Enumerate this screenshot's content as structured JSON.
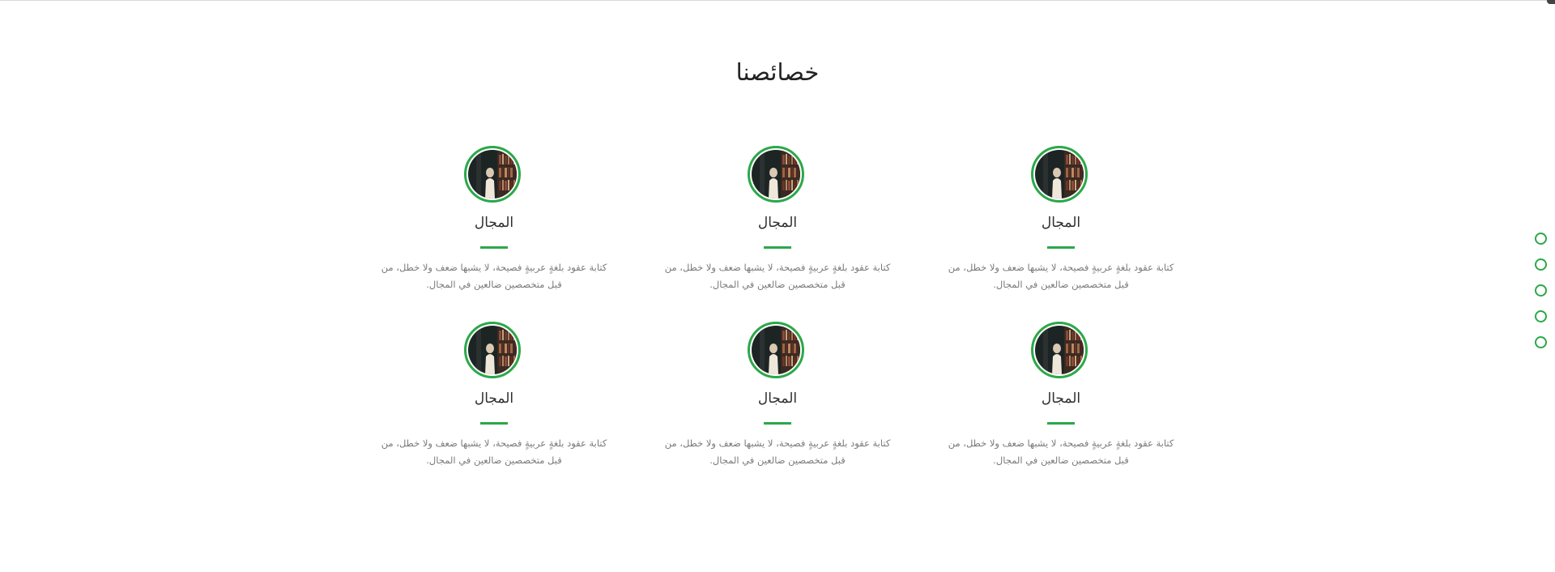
{
  "section": {
    "title": "خصائصنا"
  },
  "features": [
    {
      "title": "المجال",
      "text": "كتابة عقود بلغةٍ عربيةٍ فصيحة، لا يشبها ضعف ولا خطل، من قبل متخصصين ضالعين في المجال.",
      "image": "library-photo"
    },
    {
      "title": "المجال",
      "text": "كتابة عقود بلغةٍ عربيةٍ فصيحة، لا يشبها ضعف ولا خطل، من قبل متخصصين ضالعين في المجال.",
      "image": "library-photo"
    },
    {
      "title": "المجال",
      "text": "كتابة عقود بلغةٍ عربيةٍ فصيحة، لا يشبها ضعف ولا خطل، من قبل متخصصين ضالعين في المجال.",
      "image": "library-photo"
    },
    {
      "title": "المجال",
      "text": "كتابة عقود بلغةٍ عربيةٍ فصيحة، لا يشبها ضعف ولا خطل، من قبل متخصصين ضالعين في المجال.",
      "image": "library-photo"
    },
    {
      "title": "المجال",
      "text": "كتابة عقود بلغةٍ عربيةٍ فصيحة، لا يشبها ضعف ولا خطل، من قبل متخصصين ضالعين في المجال.",
      "image": "library-photo"
    },
    {
      "title": "المجال",
      "text": "كتابة عقود بلغةٍ عربيةٍ فصيحة، لا يشبها ضعف ولا خطل، من قبل متخصصين ضالعين في المجال.",
      "image": "library-photo"
    }
  ],
  "dot_nav": {
    "count": 5,
    "active_index": null
  },
  "colors": {
    "accent": "#2ba84a",
    "title": "#222222",
    "body_text": "#7a7a7a"
  }
}
